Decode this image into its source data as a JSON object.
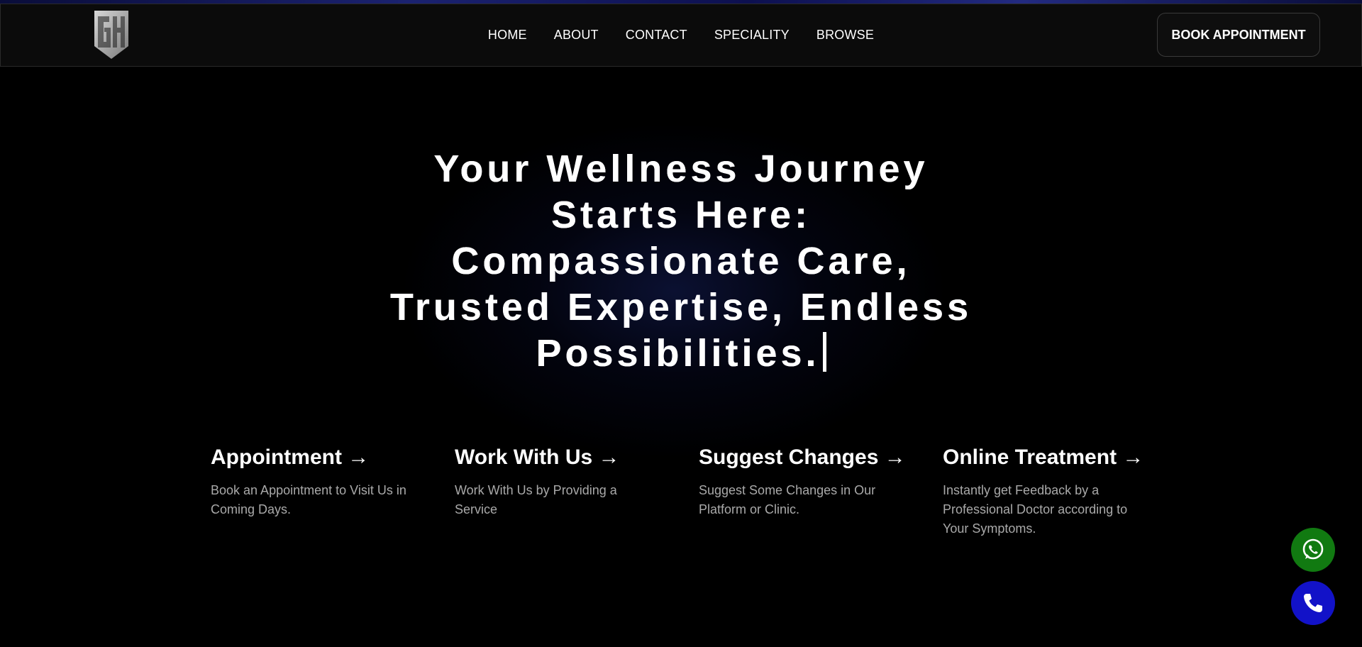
{
  "brand": {
    "logo_text": "GH"
  },
  "nav": {
    "links": [
      {
        "label": "HOME"
      },
      {
        "label": "ABOUT"
      },
      {
        "label": "CONTACT"
      },
      {
        "label": "SPECIALITY"
      },
      {
        "label": "BROWSE"
      }
    ],
    "cta_label": "BOOK APPOINTMENT"
  },
  "hero": {
    "lines": [
      "Your Wellness Journey",
      "Starts Here:",
      "Compassionate Care,",
      "Trusted Expertise, Endless",
      "Possibilities."
    ]
  },
  "features": [
    {
      "title": "Appointment →",
      "description": "Book an Appointment to Visit Us in Coming Days."
    },
    {
      "title": "Work With Us →",
      "description": "Work With Us by Providing a Service"
    },
    {
      "title": "Suggest Changes →",
      "description": "Suggest Some Changes in Our Platform or Clinic."
    },
    {
      "title": "Online Treatment →",
      "description": "Instantly get Feedback by a Professional Doctor according to Your Symptoms."
    }
  ],
  "floating_actions": {
    "whatsapp_icon": "whatsapp-icon",
    "phone_icon": "phone-icon",
    "whatsapp_color": "#117a11",
    "phone_color": "#1212c8"
  },
  "colors": {
    "background": "#000000",
    "navbar": "#0b0b0b",
    "text": "#ffffff",
    "muted_text": "#a9a9a9"
  }
}
